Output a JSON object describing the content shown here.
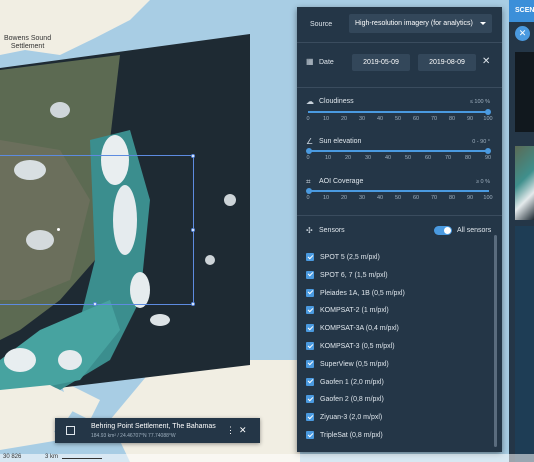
{
  "map": {
    "place_label": "Bowens Sound\nSettlement",
    "coords_readout": "30 826",
    "scale_label": "3 km"
  },
  "filters": {
    "source_label": "Source",
    "source_value": "High-resolution imagery (for analytics)",
    "date_label": "Date",
    "date_from": "2019-05-09",
    "date_to": "2019-08-09",
    "cloudiness": {
      "label": "Cloudiness",
      "value_text": "≤ 100 %",
      "value": 100
    },
    "sun_elevation": {
      "label": "Sun elevation",
      "value_text": "0 - 90 °",
      "range": [
        0,
        90
      ]
    },
    "aoi_coverage": {
      "label": "AOI Coverage",
      "value_text": "≥ 0 %",
      "value": 0
    },
    "tick_labels": [
      "0",
      "10",
      "20",
      "30",
      "40",
      "50",
      "60",
      "70",
      "80",
      "90",
      "100"
    ],
    "sun_tick_labels": [
      "0",
      "10",
      "20",
      "30",
      "40",
      "50",
      "60",
      "70",
      "80",
      "90"
    ],
    "sensors_label": "Sensors",
    "all_sensors_label": "All sensors",
    "sensors": [
      "SPOT 5 (2,5 m/pxl)",
      "SPOT 6, 7 (1,5 m/pxl)",
      "Pleiades 1A, 1B (0,5 m/pxl)",
      "KOMPSAT-2 (1 m/pxl)",
      "KOMPSAT-3A (0,4 m/pxl)",
      "KOMPSAT-3 (0,5 m/pxl)",
      "SuperView (0,5 m/pxl)",
      "Gaofen 1 (2,0 m/pxl)",
      "Gaofen 2 (0,8 m/pxl)",
      "Ziyuan-3 (2,0 m/pxl)",
      "TripleSat (0,8 m/pxl)"
    ]
  },
  "scenes_panel": {
    "header": "SCEN",
    "close_icon": "close-icon"
  },
  "aoi_card": {
    "title": "Behring Point Settlement, The Bahamas",
    "subtitle": "184.93 km² / 24.46707°N 77.74088°W"
  },
  "colors": {
    "accent": "#4a9ae0",
    "panel": "#243647",
    "header_blue": "#3b8fd9",
    "sea": "#a8cde4"
  }
}
